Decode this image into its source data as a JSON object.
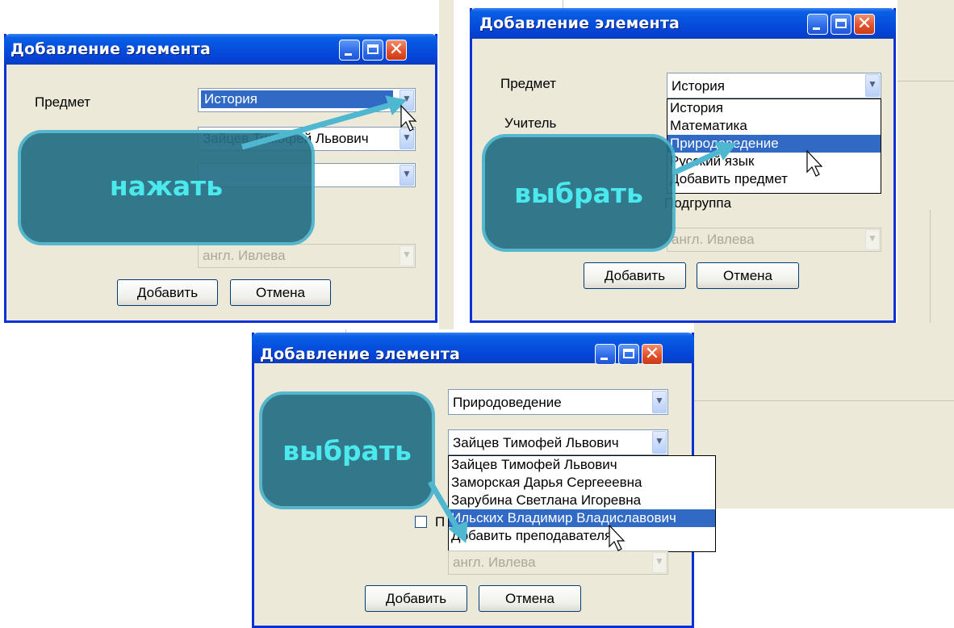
{
  "colors": {
    "titlebar": "#0551df",
    "callout_bg": "#256f85",
    "callout_text": "#3fe9ef",
    "highlight": "#316ac5",
    "window_bg": "#ece9d8"
  },
  "icons": [
    "minimize-icon",
    "maximize-icon",
    "close-icon",
    "chevron-down-icon",
    "mouse-cursor-icon",
    "arrow-pointer"
  ],
  "step1": {
    "title": "Добавление элемента",
    "subject_label": "Предмет",
    "subject_value": "История",
    "teacher_value": "Зайцев Тимофей Львович",
    "group_value": "англ. Ивлева",
    "add_label": "Добавить",
    "cancel_label": "Отмена",
    "callout": "нажать"
  },
  "step2": {
    "title": "Добавление элемента",
    "subject_label": "Предмет",
    "teacher_label": "Учитель",
    "subject_value": "История",
    "options": [
      "История",
      "Математика",
      "Природоведение",
      "Русский язык",
      "Добавить предмет"
    ],
    "highlighted": "Природоведение",
    "hidden_label": "Подгруппа",
    "group_value": "англ. Ивлева",
    "add_label": "Добавить",
    "cancel_label": "Отмена",
    "callout": "выбрать"
  },
  "step3": {
    "title": "Добавление элемента",
    "subject_value": "Природоведение",
    "teacher_value": "Зайцев Тимофей Львович",
    "options": [
      "Зайцев Тимофей Львович",
      "Заморская Дарья Сергееевна",
      "Зарубина Светлана Игоревна",
      "Ильских Владимир Владиславович",
      "Добавить преподавателя"
    ],
    "highlighted": "Ильских Владимир Владиславович",
    "checkbox_label": "П",
    "group_value": "англ. Ивлева",
    "add_label": "Добавить",
    "cancel_label": "Отмена",
    "callout": "выбрать"
  }
}
